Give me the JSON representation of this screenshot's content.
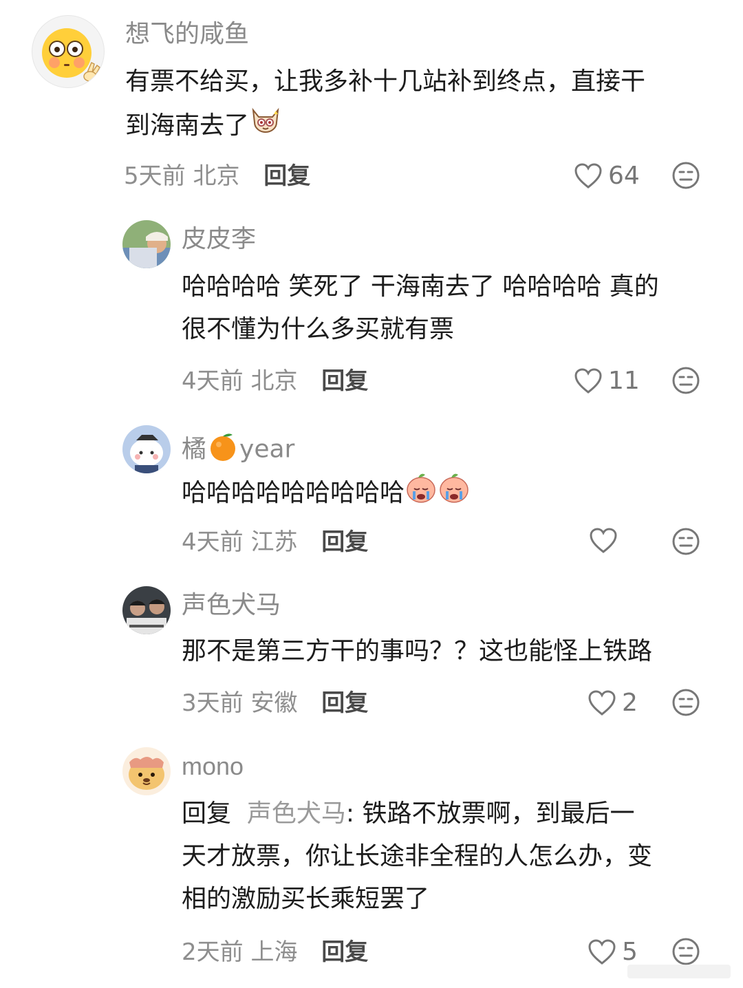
{
  "comments": [
    {
      "name": "想飞的咸鱼",
      "lines": [
        "有票不给买，让我多补十几站补到终点，直接干",
        "到海南去了"
      ],
      "time": "5天前",
      "location": "北京",
      "reply_label": "回复",
      "likes": "64",
      "emoji": "cat-emoji"
    },
    {
      "name": "皮皮李",
      "lines": [
        "哈哈哈哈 笑死了 干海南去了 哈哈哈哈 真的",
        "很不懂为什么多买就有票"
      ],
      "time": "4天前",
      "location": "北京",
      "reply_label": "回复",
      "likes": "11"
    },
    {
      "name_prefix": "橘",
      "name_suffix": "year",
      "name_emoji": "orange-emoji",
      "lines": [
        "哈哈哈哈哈哈哈哈哈"
      ],
      "time": "4天前",
      "location": "江苏",
      "reply_label": "回复",
      "likes": "",
      "emoji": "crying-peach-emoji"
    },
    {
      "name": "声色犬马",
      "lines": [
        "那不是第三方干的事吗？？这也能怪上铁路"
      ],
      "time": "3天前",
      "location": "安徽",
      "reply_label": "回复",
      "likes": "2"
    },
    {
      "name": "mono",
      "reply_prefix": "回复",
      "reply_to": "声色犬马",
      "line1_rest": ": 铁路不放票啊，到最后一",
      "lines": [
        "天才放票，你让长途非全程的人怎么办，变",
        "相的激励买长乘短罢了"
      ],
      "time": "2天前",
      "location": "上海",
      "reply_label": "回复",
      "likes": "5"
    }
  ],
  "icons": {
    "like": "heart-outline-icon",
    "dislike": "meh-face-icon"
  },
  "colors": {
    "name": "#8a8a8a",
    "text": "#1c1c1c",
    "meta": "#8e8e8e"
  }
}
